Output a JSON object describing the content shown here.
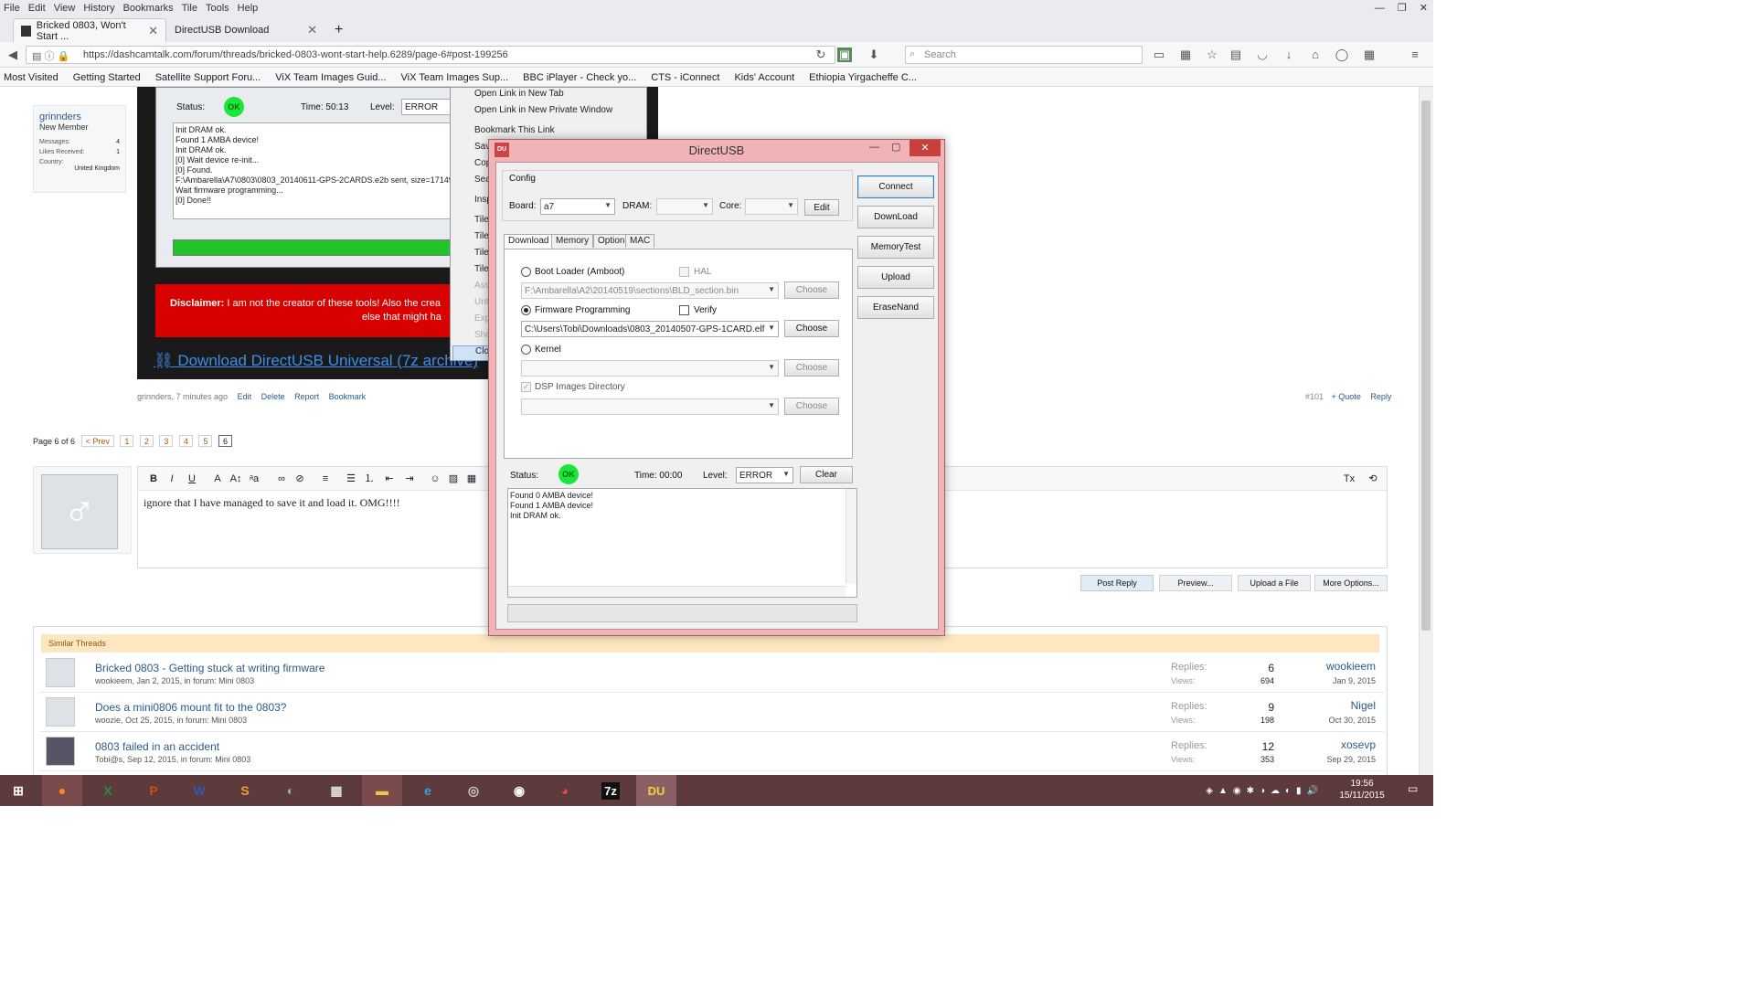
{
  "menu": [
    "File",
    "Edit",
    "View",
    "History",
    "Bookmarks",
    "Tile",
    "Tools",
    "Help"
  ],
  "browser": {
    "tabs": [
      {
        "label": "Bricked 0803, Won't Start ..."
      },
      {
        "label": "DirectUSB Download"
      }
    ],
    "new_tab": "+",
    "url": "https://dashcamtalk.com/forum/threads/bricked-0803-wont-start-help.6289/page-6#post-199256",
    "search_placeholder": "Search"
  },
  "bookmarks": [
    "Most Visited",
    "Getting Started",
    "Satellite Support Foru...",
    "ViX Team Images Guid...",
    "ViX Team Images Sup...",
    "BBC iPlayer - Check yo...",
    "CTS - iConnect",
    "Kids' Account",
    "Ethiopia Yirgacheffe C..."
  ],
  "post": {
    "username": "grinnders",
    "role": "New Member",
    "stats": [
      {
        "label": "Messages:",
        "value": "4"
      },
      {
        "label": "Likes Received:",
        "value": "1"
      },
      {
        "label": "Country:",
        "value": ""
      }
    ],
    "country": "United Kingdom",
    "inner_status": "Status:",
    "inner_ok": "OK",
    "inner_time": "Time: 50:13",
    "inner_level": "Level:",
    "inner_level_value": "ERROR",
    "inner_log": [
      "Init DRAM ok.",
      "Found 1 AMBA device!",
      "Init DRAM ok.",
      "[0] Wait device re-init...",
      "[0] Found.",
      "F:\\Ambarella\\A7\\0803\\0803_20140611-GPS-2CARDS.e2b sent, size=17149",
      "Wait firmware programming...",
      "[0] Done!!"
    ],
    "disclaimer_bold": "Disclaimer:",
    "disclaimer_text": " I am not the creator of these tools! Also the crea",
    "disclaimer_text2": "else that might ha",
    "download_link": "Download DirectUSB Universal (7z archive)",
    "meta": "grinnders, 7 minutes ago",
    "actions": [
      "Edit",
      "Delete",
      "Report",
      "Bookmark"
    ],
    "post_number": "#101",
    "quote": "+ Quote",
    "reply": "Reply"
  },
  "context_menu": {
    "items": [
      "Open Link in New Tab",
      "Open Link in New Private Window",
      "Bookmark This Link",
      "Sav",
      "Cop",
      "Sea",
      "Insp",
      "Tile",
      "Tile",
      "Tile",
      "Tile",
      "Ass",
      "Unt",
      "Exp",
      "Sho",
      "Clo"
    ]
  },
  "pagination": {
    "label": "Page 6 of 6",
    "prev": "< Prev",
    "pages": [
      "1",
      "2",
      "3",
      "4",
      "5",
      "6"
    ]
  },
  "editor": {
    "text": "ignore that I have managed to save it and load it. OMG!!!!",
    "buttons": [
      "B",
      "I",
      "U"
    ]
  },
  "reply_buttons": [
    "Post Reply",
    "Preview...",
    "Upload a File",
    "More Options..."
  ],
  "similar": {
    "header": "Similar Threads",
    "threads": [
      {
        "title": "Bricked 0803 - Getting stuck at writing firmware",
        "meta": "wookieem, Jan 2, 2015, in forum: Mini 0803",
        "replies": "6",
        "views": "694",
        "last_user": "wookieem",
        "last_date": "Jan 9, 2015"
      },
      {
        "title": "Does a mini0806 mount fit to the 0803?",
        "meta": "woozie, Oct 25, 2015, in forum: Mini 0803",
        "replies": "9",
        "views": "198",
        "last_user": "Nigel",
        "last_date": "Oct 30, 2015"
      },
      {
        "title": "0803 failed in an accident",
        "meta": "Tobi@s, Sep 12, 2015, in forum: Mini 0803",
        "replies": "12",
        "views": "353",
        "last_user": "xosevp",
        "last_date": "Sep 29, 2015"
      }
    ],
    "replies_label": "Replies:",
    "views_label": "Views:"
  },
  "dialog": {
    "title": "DirectUSB",
    "config_label": "Config",
    "board_label": "Board:",
    "board_value": "a7",
    "dram_label": "DRAM:",
    "core_label": "Core:",
    "edit_button": "Edit",
    "tabs": [
      "Download",
      "Memory",
      "Option",
      "MAC"
    ],
    "bootloader_label": "Boot Loader (Amboot)",
    "hal_label": "HAL",
    "bootloader_path": "F:\\Ambarella\\A2\\20140519\\sections\\BLD_section.bin",
    "firmware_label": "Firmware Programming",
    "verify_label": "Verify",
    "firmware_path": "C:\\Users\\Tobi\\Downloads\\0803_20140507-GPS-1CARD.elf",
    "kernel_label": "Kernel",
    "dsp_label": "DSP Images Directory",
    "choose": "Choose",
    "side_buttons": [
      "Connect",
      "DownLoad",
      "MemoryTest",
      "Upload",
      "EraseNand"
    ],
    "status_label": "Status:",
    "ok": "OK",
    "time": "Time: 00:00",
    "level_label": "Level:",
    "level_value": "ERROR",
    "clear": "Clear",
    "log": [
      "Found 0 AMBA device!",
      "Found 1 AMBA device!",
      "Init DRAM ok."
    ]
  },
  "clock": {
    "time": "19:56",
    "date": "15/11/2015"
  },
  "taskbar_apps": [
    "firefox-icon",
    "excel-icon",
    "powerpoint-icon",
    "word-icon",
    "sway-icon",
    "paint-icon",
    "calculator-icon",
    "explorer-icon",
    "ie-icon",
    "gimp-icon",
    "camera-icon",
    "chrome-icon",
    "7zip-icon",
    "directusb-icon"
  ],
  "taskbar_labels": {
    "7zip": "7z",
    "directusb": "DU"
  },
  "colors": {
    "taskbar": "#5d3a3c",
    "dialog_frame": "#f0b4b8",
    "ok_green": "#1ae63a",
    "disclaimer_red": "#d90000"
  }
}
